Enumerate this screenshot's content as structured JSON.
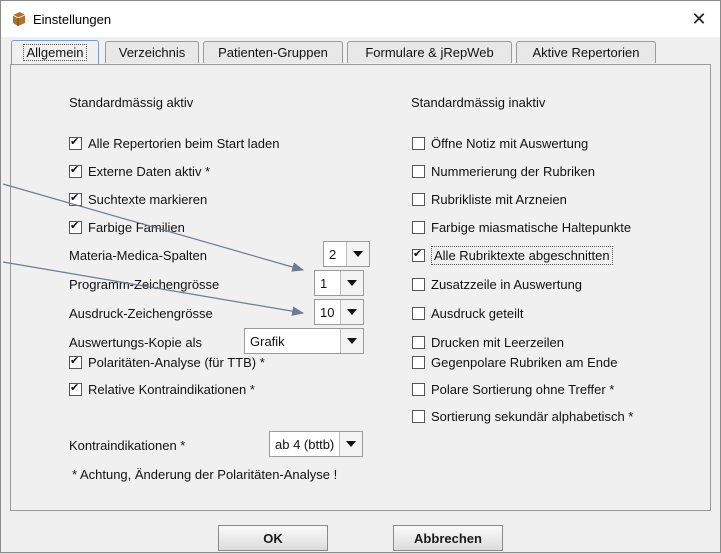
{
  "window": {
    "title": "Einstellungen",
    "close_glyph": "✕"
  },
  "tabs": [
    {
      "label": "Allgemein"
    },
    {
      "label": "Verzeichnis"
    },
    {
      "label": "Patienten-Gruppen"
    },
    {
      "label": "Formulare & jRepWeb"
    },
    {
      "label": "Aktive Repertorien"
    }
  ],
  "left": {
    "heading": "Standardmässig aktiv",
    "checks": [
      {
        "label": "Alle Repertorien beim Start laden",
        "checked": true
      },
      {
        "label": "Externe Daten aktiv *",
        "checked": true
      },
      {
        "label": "Suchtexte markieren",
        "checked": true
      },
      {
        "label": "Farbige Familien",
        "checked": true
      }
    ],
    "materia_medica": {
      "label": "Materia-Medica-Spalten",
      "value": "2"
    },
    "prog_font": {
      "label": "Programm-Zeichengrösse",
      "value": "1"
    },
    "print_font": {
      "label": "Ausdruck-Zeichengrösse",
      "value": "10"
    },
    "copy_as": {
      "label": "Auswertungs-Kopie als",
      "value": "Grafik"
    },
    "polarity": {
      "label": "Polaritäten-Analyse (für TTB) *",
      "checked": true
    },
    "relative": {
      "label": "Relative Kontraindikationen *",
      "checked": true
    },
    "contra": {
      "label": "Kontraindikationen *",
      "value": "ab 4 (bttb)"
    },
    "note": "* Achtung, Änderung der Polaritäten-Analyse !"
  },
  "right": {
    "heading": "Standardmässig inaktiv",
    "checks": [
      {
        "label": "Öffne Notiz mit Auswertung",
        "checked": false
      },
      {
        "label": "Nummerierung der Rubriken",
        "checked": false
      },
      {
        "label": "Rubrikliste mit Arzneien",
        "checked": false
      },
      {
        "label": "Farbige miasmatische Haltepunkte",
        "checked": false
      },
      {
        "label": "Alle Rubriktexte abgeschnitten",
        "checked": true
      },
      {
        "label": "Zusatzzeile in Auswertung",
        "checked": false
      },
      {
        "label": "Ausdruck geteilt",
        "checked": false
      },
      {
        "label": "Drucken mit Leerzeilen",
        "checked": false
      }
    ],
    "checks2": [
      {
        "label": "Gegenpolare Rubriken am Ende",
        "checked": false
      },
      {
        "label": "Polare Sortierung ohne Treffer *",
        "checked": false
      },
      {
        "label": "Sortierung sekundär alphabetisch *",
        "checked": false
      }
    ]
  },
  "buttons": {
    "ok": "OK",
    "cancel": "Abbrechen"
  },
  "colors": {
    "active_tab_border": "#7a9cc8",
    "arrow": "#6a7d93"
  },
  "icons": {
    "title": "book-icon",
    "close": "close-icon"
  }
}
